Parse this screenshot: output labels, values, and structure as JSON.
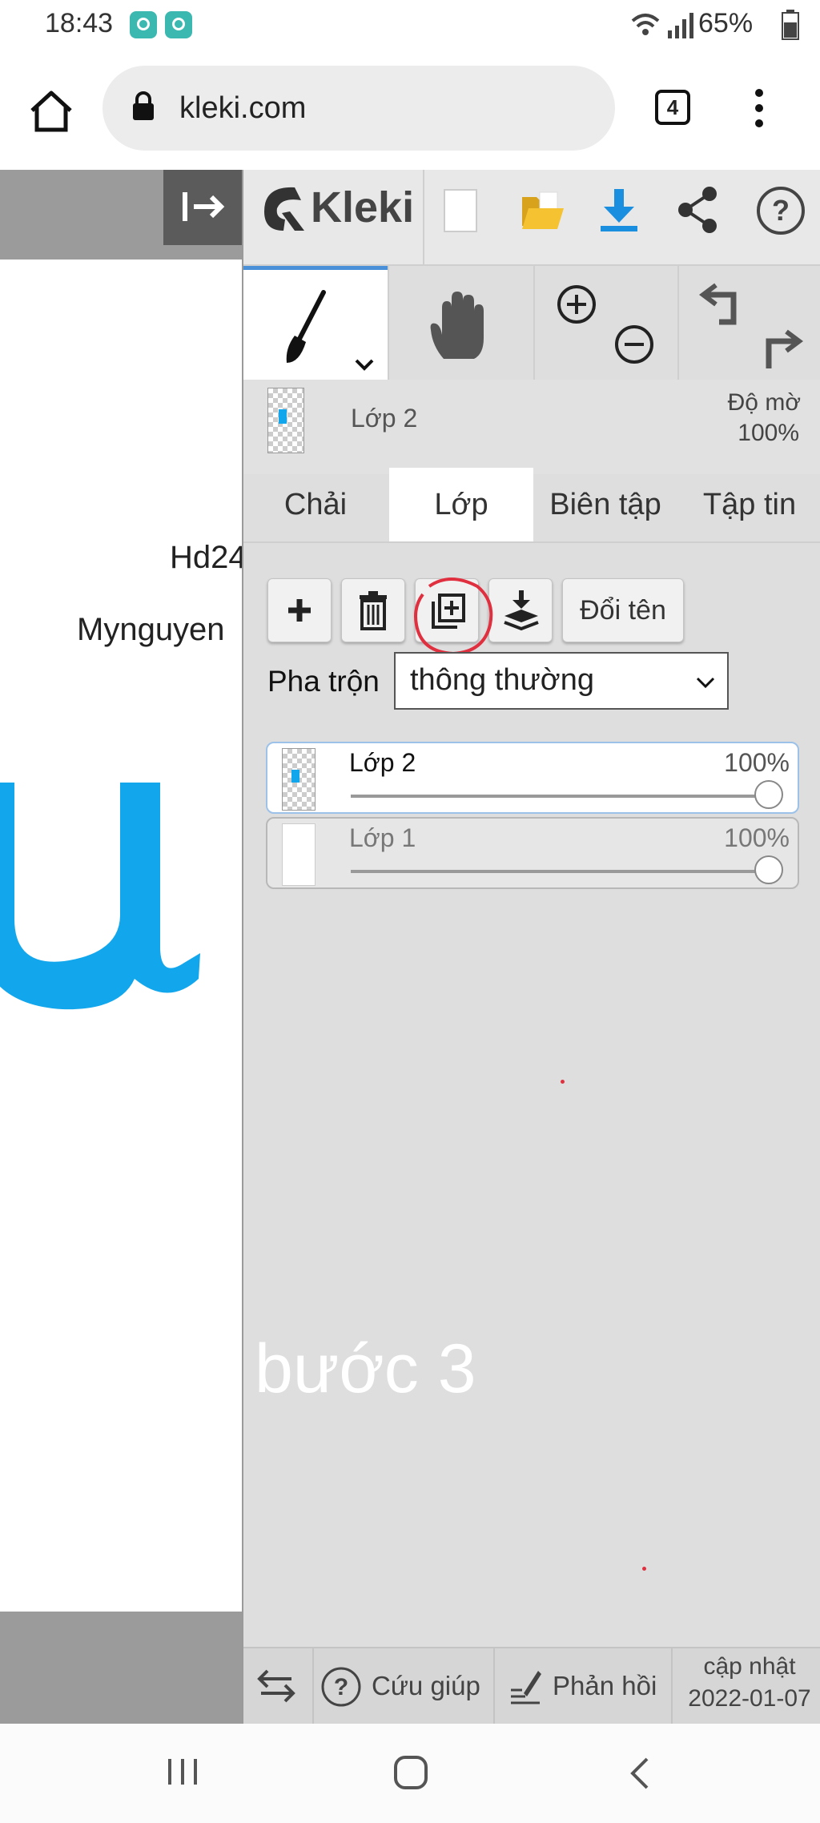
{
  "status_bar": {
    "time": "18:43",
    "battery": "65%"
  },
  "browser": {
    "url": "kleki.com",
    "tab_count": "4"
  },
  "canvas": {
    "text_line1": "Hd24",
    "text_line2": "Mynguyen"
  },
  "app": {
    "logo": "Kleki"
  },
  "layer_header": {
    "name": "Lớp 2",
    "opacity_label": "Độ mờ",
    "opacity_value": "100%"
  },
  "tabs": [
    "Chải",
    "Lớp",
    "Biên tập",
    "Tập tin"
  ],
  "layer_panel": {
    "rename_label": "Đổi tên",
    "blend_label": "Pha trộn",
    "blend_value": "thông thường",
    "layers": [
      {
        "name": "Lớp 2",
        "opacity": "100%",
        "opacity_value": 1.0
      },
      {
        "name": "Lớp 1",
        "opacity": "100%",
        "opacity_value": 1.0
      }
    ]
  },
  "overlay_caption": "bước 3",
  "footer": {
    "help": "Cứu giúp",
    "feedback": "Phản hồi",
    "update_label": "cập nhật",
    "update_date": "2022-01-07"
  },
  "colors": {
    "accent_blue": "#1a8fe0",
    "brush_stroke": "#12a6ec",
    "annotation_red": "#e0303f"
  }
}
